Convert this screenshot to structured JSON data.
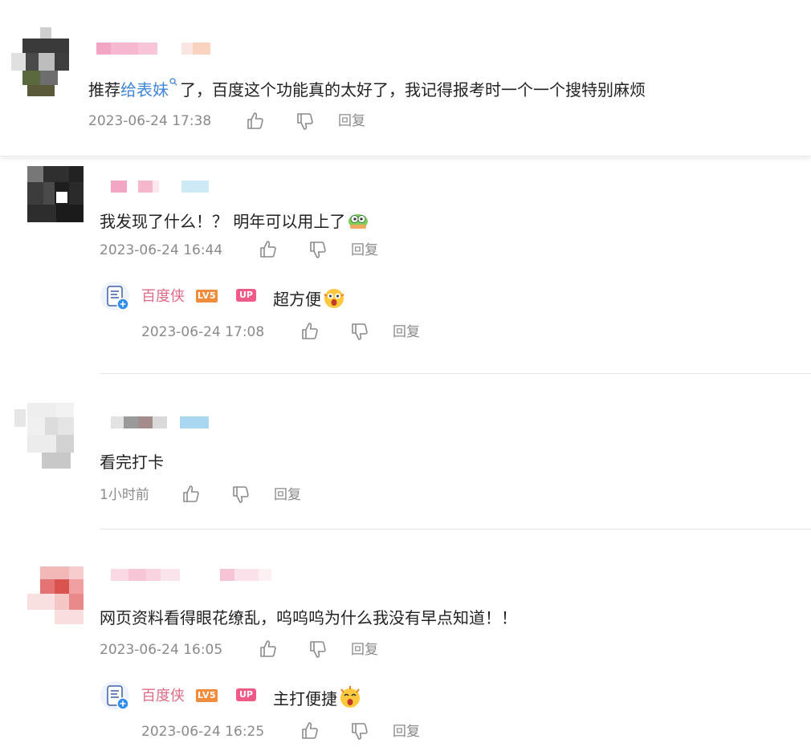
{
  "comments": [
    {
      "text_prefix": "推荐",
      "link_text": "给表妹",
      "text_suffix": "了，百度这个功能真的太好了，我记得报考时一个一个搜特别麻烦",
      "timestamp": "2023-06-24 17:38",
      "reply_label": "回复"
    },
    {
      "text": "我发现了什么！？ 明年可以用上了",
      "timestamp": "2023-06-24 16:44",
      "reply_label": "回复",
      "sub_reply": {
        "name": "百度侠",
        "level_badge": "LV5",
        "up_badge": "UP",
        "text": "超方便",
        "timestamp": "2023-06-24 17:08",
        "reply_label": "回复"
      }
    },
    {
      "text": "看完打卡",
      "timestamp": "1小时前",
      "reply_label": "回复"
    },
    {
      "text": "网页资料看得眼花缭乱，呜呜呜为什么我没有早点知道！！",
      "timestamp": "2023-06-24 16:05",
      "reply_label": "回复",
      "sub_reply": {
        "name": "百度侠",
        "level_badge": "LV5",
        "up_badge": "UP",
        "text": "主打便捷",
        "timestamp": "2023-06-24 16:25",
        "reply_label": "回复"
      }
    }
  ],
  "colors": {
    "link": "#3f86d4",
    "meta": "#8a8a8a",
    "official_name": "#e06a86",
    "level_badge": "#f08c3c",
    "up_badge": "#f05a86"
  },
  "icons": [
    "like-icon",
    "dislike-icon",
    "search-icon",
    "verified-icon",
    "emoji-icon"
  ]
}
